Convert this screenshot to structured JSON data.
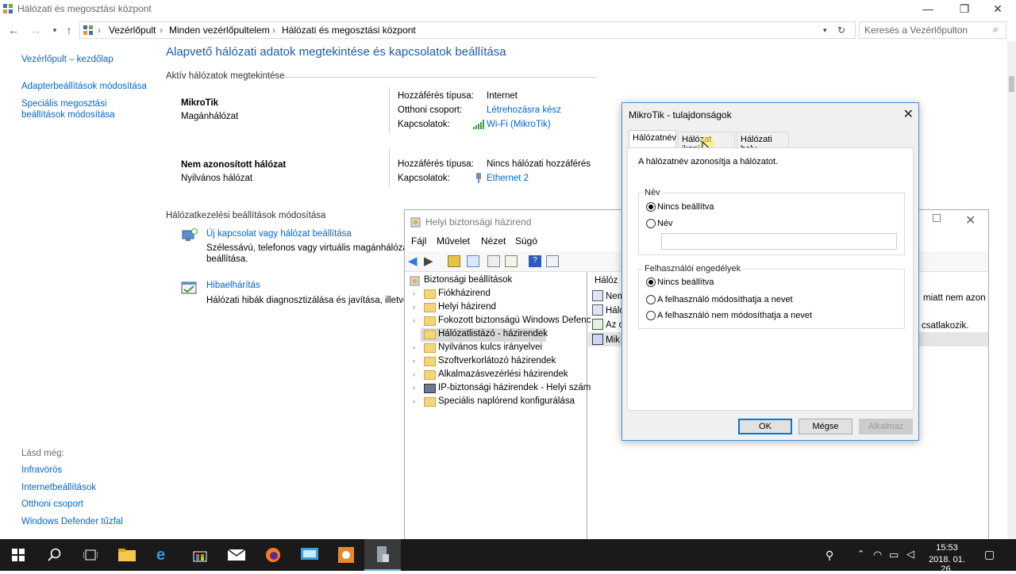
{
  "window": {
    "title": "Hálózati és megosztási központ",
    "minimize": "—",
    "maximize": "❐",
    "close": "✕"
  },
  "breadcrumb": [
    "Vezérlőpult",
    "Minden vezérlőpultelem",
    "Hálózati és megosztási központ"
  ],
  "search": {
    "placeholder": "Keresés a Vezérlőpulton"
  },
  "left_pane": {
    "home": "Vezérlőpult – kezdőlap",
    "adapter": "Adapterbeállítások módosítása",
    "advanced_line1": "Speciális megosztási",
    "advanced_line2": "beállítások módosítása",
    "see_also": "Lásd még:",
    "links": [
      "Infravörös",
      "Internetbeállítások",
      "Otthoni csoport",
      "Windows Defender tűzfal"
    ]
  },
  "main": {
    "title": "Alapvető hálózati adatok megtekintése és kapcsolatok beállítása",
    "active_networks": "Aktív hálózatok megtekintése",
    "net1": {
      "name": "MikroTik",
      "type": "Magánhálózat",
      "access_label": "Hozzáférés típusa:",
      "access_value": "Internet",
      "homegroup_label": "Otthoni csoport:",
      "homegroup_value": "Létrehozásra kész",
      "conn_label": "Kapcsolatok:",
      "conn_value": "Wi-Fi (MikroTik)"
    },
    "net2": {
      "name": "Nem azonosított hálózat",
      "type": "Nyilvános hálózat",
      "access_label": "Hozzáférés típusa:",
      "access_value": "Nincs hálózati hozzáférés",
      "conn_label": "Kapcsolatok:",
      "conn_value": "Ethernet 2"
    },
    "change_settings": "Hálózatkezelési beállítások módosítása",
    "task1": {
      "title": "Új kapcsolat vagy hálózat beállítása",
      "desc1": "Szélessávú, telefonos vagy virtuális magánhálózati",
      "desc2": "beállítása."
    },
    "task2": {
      "title": "Hibaelhárítás",
      "desc1": "Hálózati hibák diagnosztizálása és javítása, illetve hi"
    }
  },
  "lsp": {
    "title": "Helyi biztonsági házirend",
    "menu": [
      "Fájl",
      "Művelet",
      "Nézet",
      "Súgó"
    ],
    "tree_root": "Biztonsági beállítások",
    "tree": [
      "Fiókházirend",
      "Helyi házirend",
      "Fokozott biztonságú Windows Defenc",
      "Hálózatlistázó - házirendek",
      "Nyilvános kulcs irányelvei",
      "Szoftverkorlátozó házirendek",
      "Alkalmazásvezérlési házirendek",
      "IP-biztonsági házirendek - Helyi szám",
      "Speciális naplórend konfigurálása"
    ],
    "right_header": "Hálóz",
    "right_items": [
      "Nem",
      "Háló",
      "Az c",
      "Mik"
    ],
    "right_text1": "miatt nem azon",
    "right_text2": "csatlakozik."
  },
  "dialog": {
    "title": "MikroTik - tulajdonságok",
    "tabs": [
      "Hálózatnév",
      "Hálózat ikonja",
      "Hálózati hely"
    ],
    "description": "A hálózatnév azonosítja a hálózatot.",
    "name_group": "Név",
    "name_opt1": "Nincs beállítva",
    "name_opt2": "Név",
    "perm_group": "Felhasználói engedélyek",
    "perm_opt1": "Nincs beállítva",
    "perm_opt2": "A felhasználó módosíthatja a nevet",
    "perm_opt3": "A felhasználó nem módosíthatja a nevet",
    "ok": "OK",
    "cancel": "Mégse",
    "apply": "Alkalmaz"
  },
  "taskbar": {
    "time": "15:53",
    "date": "2018. 01. 26."
  }
}
